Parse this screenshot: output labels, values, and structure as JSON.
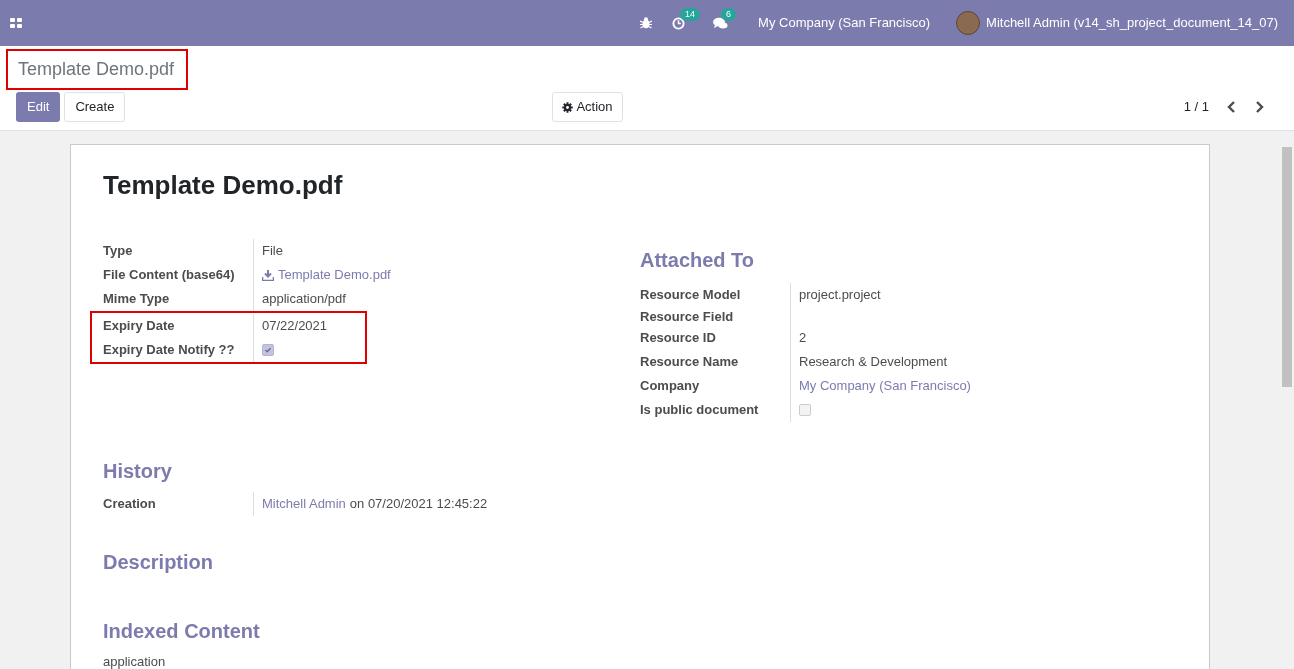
{
  "navbar": {
    "activity_count": "14",
    "message_count": "6",
    "company": "My Company (San Francisco)",
    "user": "Mitchell Admin (v14_sh_project_document_14_07)"
  },
  "breadcrumb": {
    "title": "Template Demo.pdf",
    "highlighted": true
  },
  "buttons": {
    "edit": "Edit",
    "create": "Create",
    "action": "Action"
  },
  "pager": {
    "value": "1 / 1"
  },
  "record": {
    "title": "Template Demo.pdf",
    "left_fields": [
      {
        "label": "Type",
        "kind": "text",
        "value": "File",
        "highlighted": false
      },
      {
        "label": "File Content (base64)",
        "kind": "file",
        "value": "Template Demo.pdf",
        "highlighted": false
      },
      {
        "label": "Mime Type",
        "kind": "text",
        "value": "application/pdf",
        "highlighted": false
      },
      {
        "label": "Expiry Date",
        "kind": "text",
        "value": "07/22/2021",
        "highlighted": true
      },
      {
        "label": "Expiry Date Notify ??",
        "kind": "checkbox",
        "checked": true,
        "highlighted": true
      }
    ],
    "attached_to": {
      "heading": "Attached To",
      "fields": [
        {
          "label": "Resource Model",
          "kind": "text",
          "value": "project.project"
        },
        {
          "label": "Resource Field",
          "kind": "empty"
        },
        {
          "label": "Resource ID",
          "kind": "text",
          "value": "2"
        },
        {
          "label": "Resource Name",
          "kind": "text",
          "value": "Research & Development"
        },
        {
          "label": "Company",
          "kind": "link",
          "value": "My Company (San Francisco)"
        },
        {
          "label": "Is public document",
          "kind": "checkbox",
          "checked": false
        }
      ]
    },
    "history": {
      "heading": "History",
      "label": "Creation",
      "user": "Mitchell Admin",
      "text": "on 07/20/2021 12:45:22"
    },
    "description": {
      "heading": "Description"
    },
    "indexed_content": {
      "heading": "Indexed Content",
      "text": "application"
    }
  }
}
